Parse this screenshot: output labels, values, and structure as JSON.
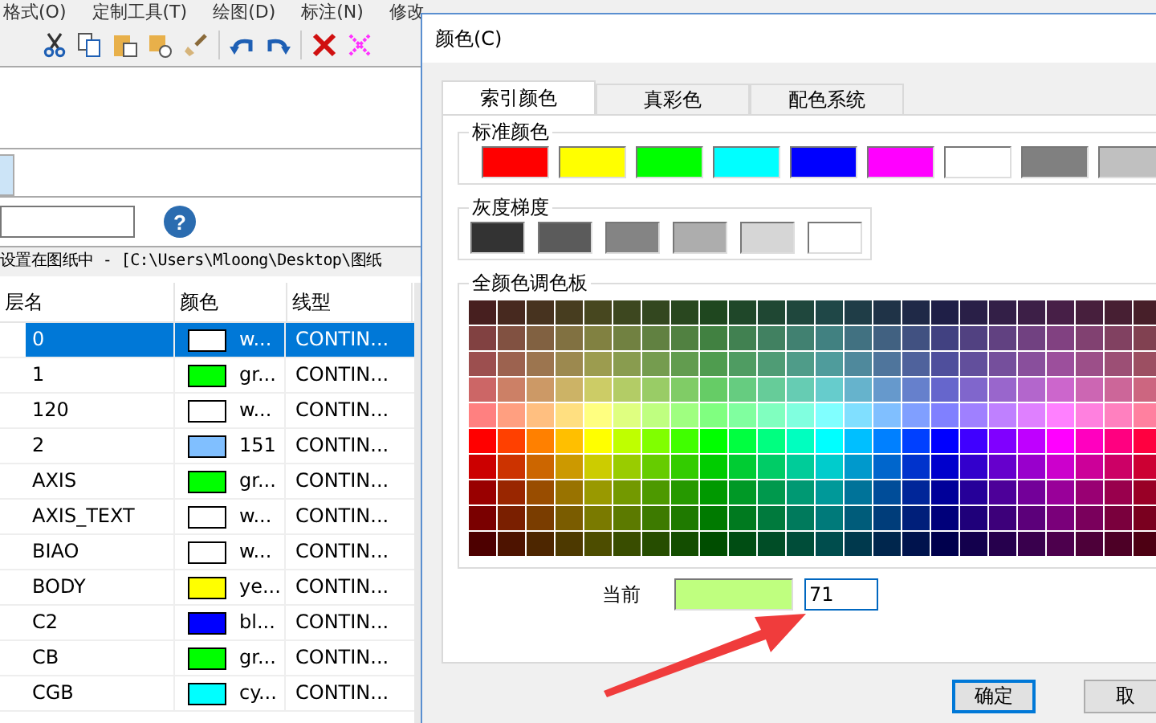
{
  "menu": [
    "格式(O)",
    "定制工具(T)",
    "绘图(D)",
    "标注(N)",
    "修改"
  ],
  "help_button": {
    "label": "?"
  },
  "status_path": "设置在图纸中 - [C:\\Users\\Mloong\\Desktop\\图纸",
  "layer_table": {
    "columns": [
      "层名",
      "颜色",
      "线型"
    ],
    "rows": [
      {
        "name": "0",
        "color": "#ffffff",
        "color_name": "w...",
        "linetype": "CONTIN...",
        "selected": true
      },
      {
        "name": "1",
        "color": "#00ff00",
        "color_name": "gr...",
        "linetype": "CONTIN...",
        "selected": false
      },
      {
        "name": "120",
        "color": "#ffffff",
        "color_name": "w...",
        "linetype": "CONTIN...",
        "selected": false
      },
      {
        "name": "2",
        "color": "#80bfff",
        "color_name": "151",
        "linetype": "CONTIN...",
        "selected": false
      },
      {
        "name": "AXIS",
        "color": "#00ff00",
        "color_name": "gr...",
        "linetype": "CONTIN...",
        "selected": false
      },
      {
        "name": "AXIS_TEXT",
        "color": "#ffffff",
        "color_name": "w...",
        "linetype": "CONTIN...",
        "selected": false
      },
      {
        "name": "BIAO",
        "color": "#ffffff",
        "color_name": "w...",
        "linetype": "CONTIN...",
        "selected": false
      },
      {
        "name": "BODY",
        "color": "#ffff00",
        "color_name": "ye...",
        "linetype": "CONTIN...",
        "selected": false
      },
      {
        "name": "C2",
        "color": "#0000ff",
        "color_name": "bl...",
        "linetype": "CONTIN...",
        "selected": false
      },
      {
        "name": "CB",
        "color": "#00ff00",
        "color_name": "gr...",
        "linetype": "CONTIN...",
        "selected": false
      },
      {
        "name": "CGB",
        "color": "#00ffff",
        "color_name": "cy...",
        "linetype": "CONTIN...",
        "selected": false
      }
    ]
  },
  "dialog": {
    "title": "颜色(C)",
    "tabs": [
      {
        "label": "索引颜色",
        "selected": true
      },
      {
        "label": "真彩色",
        "selected": false
      },
      {
        "label": "配色系统",
        "selected": false
      }
    ],
    "standard_colors": {
      "title": "标准颜色",
      "swatches": [
        {
          "color": "#ff0000"
        },
        {
          "color": "#ffff00"
        },
        {
          "color": "#00ff00"
        },
        {
          "color": "#00ffff"
        },
        {
          "color": "#0000ff"
        },
        {
          "color": "#ff00ff"
        },
        {
          "color": "#ffffff"
        },
        {
          "color": "#808080"
        },
        {
          "color": "#c0c0c0"
        }
      ]
    },
    "gray_levels": {
      "title": "灰度梯度",
      "swatches": [
        {
          "color": "#333333"
        },
        {
          "color": "#5b5b5b"
        },
        {
          "color": "#848484"
        },
        {
          "color": "#adadad"
        },
        {
          "color": "#d6d6d6"
        },
        {
          "color": "#ffffff"
        }
      ]
    },
    "full_palette": {
      "title": "全颜色调色板"
    },
    "current": {
      "label": "当前",
      "color": "#bfff7f",
      "value": "71",
      "focused": true
    },
    "buttons": [
      {
        "label": "确定",
        "default": true
      },
      {
        "label": "取",
        "default": false
      }
    ]
  }
}
